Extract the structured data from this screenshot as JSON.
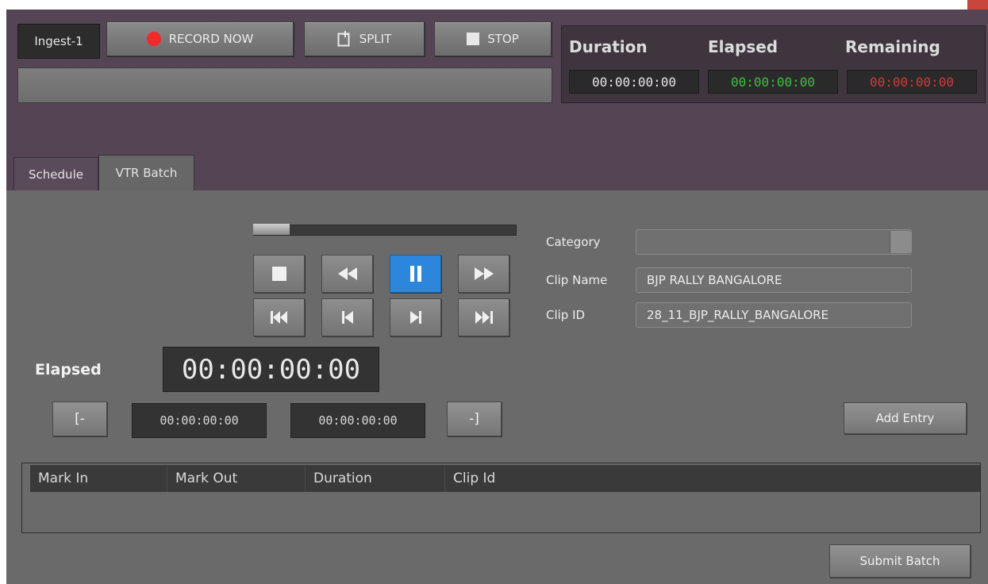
{
  "record_bar": {
    "ingest_label": "Ingest-1",
    "record_label": "RECORD NOW",
    "split_label": "SPLIT",
    "stop_label": "STOP"
  },
  "timers": {
    "duration_label": "Duration",
    "elapsed_label": "Elapsed",
    "remaining_label": "Remaining",
    "duration_value": "00:00:00:00",
    "elapsed_value": "00:00:00:00",
    "remaining_value": "00:00:00:00",
    "colors": {
      "duration": "#e6e6e6",
      "elapsed": "#3fbf3f",
      "remaining": "#d03a3a"
    }
  },
  "tabs": [
    {
      "label": "Schedule"
    },
    {
      "label": "VTR Batch",
      "active": true
    }
  ],
  "transport": {
    "scrub_position": 0.14,
    "icons": [
      "stop-icon",
      "rewind-icon",
      "pause-icon",
      "fast-forward-icon",
      "go-to-start-icon",
      "step-back-icon",
      "step-forward-icon",
      "go-to-end-icon"
    ],
    "active": "pause-icon",
    "active_color": "#2c86dc"
  },
  "form": {
    "category_label": "Category",
    "category_value": "",
    "clip_name_label": "Clip Name",
    "clip_name_value": "BJP RALLY BANGALORE",
    "clip_id_label": "Clip ID",
    "clip_id_value": "28_11_BJP_RALLY_BANGALORE"
  },
  "elapsed": {
    "label": "Elapsed",
    "value": "00:00:00:00",
    "mark_in_label": "[-",
    "mark_in_value": "00:00:00:00",
    "mark_out_value": "00:00:00:00",
    "mark_out_label": "-]"
  },
  "add_entry_label": "Add Entry",
  "table": {
    "columns": [
      "Mark In",
      "Mark Out",
      "Duration",
      "Clip Id"
    ],
    "rows": []
  },
  "submit_batch_label": "Submit Batch"
}
